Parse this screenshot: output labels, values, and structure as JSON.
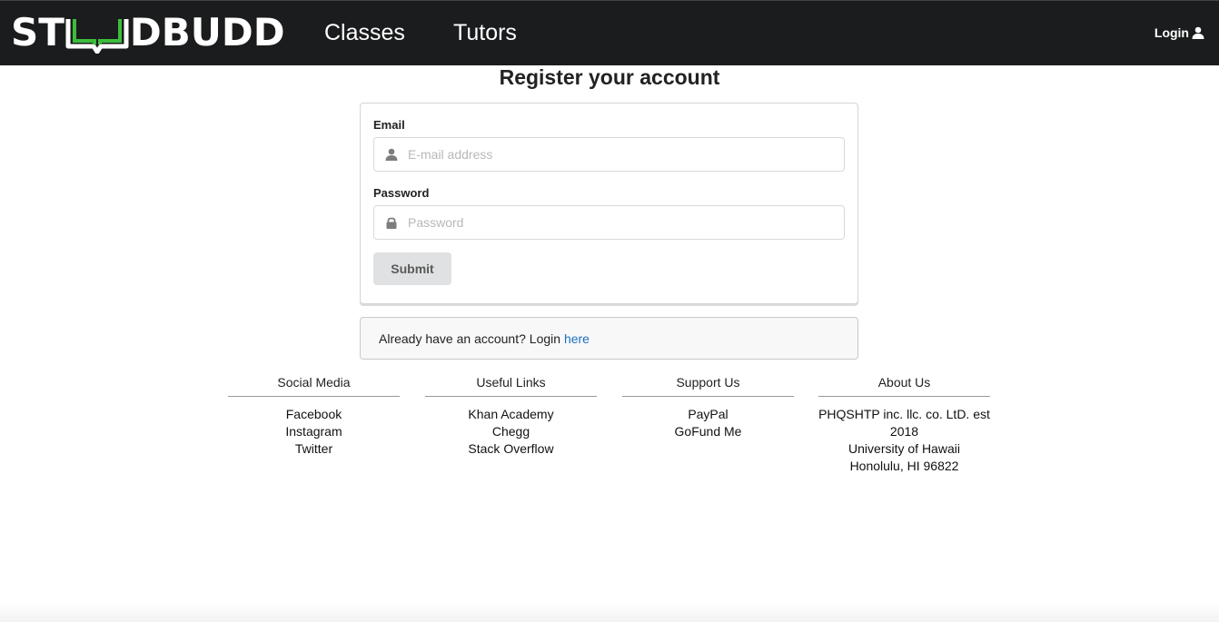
{
  "header": {
    "logo_prefix": "ST",
    "logo_suffix": "DBUDD",
    "logo_accent": "#3cbd3c",
    "nav": [
      {
        "label": "Classes"
      },
      {
        "label": "Tutors"
      }
    ],
    "login_label": "Login",
    "login_icon": "user-icon"
  },
  "page_title": "Register your account",
  "form": {
    "email_label": "Email",
    "email_placeholder": "E-mail address",
    "email_icon": "user-icon",
    "password_label": "Password",
    "password_placeholder": "Password",
    "password_icon": "lock-icon",
    "submit_label": "Submit"
  },
  "message": {
    "text": "Already have an account? Login ",
    "link_text": "here",
    "link_color": "#1e70bf"
  },
  "footer": {
    "columns": [
      {
        "title": "Social Media",
        "items": [
          "Facebook",
          "Instagram",
          "Twitter"
        ]
      },
      {
        "title": "Useful Links",
        "items": [
          "Khan Academy",
          "Chegg",
          "Stack Overflow"
        ]
      },
      {
        "title": "Support Us",
        "items": [
          "PayPal",
          "GoFund Me"
        ]
      },
      {
        "title": "About Us",
        "items": [
          "PHQSHTP inc. llc. co. LtD. est",
          "2018",
          "University of Hawaii",
          "Honolulu, HI 96822"
        ]
      }
    ]
  },
  "colors": {
    "navbar_bg": "#1b1c1d",
    "button_bg": "#e0e1e2"
  }
}
